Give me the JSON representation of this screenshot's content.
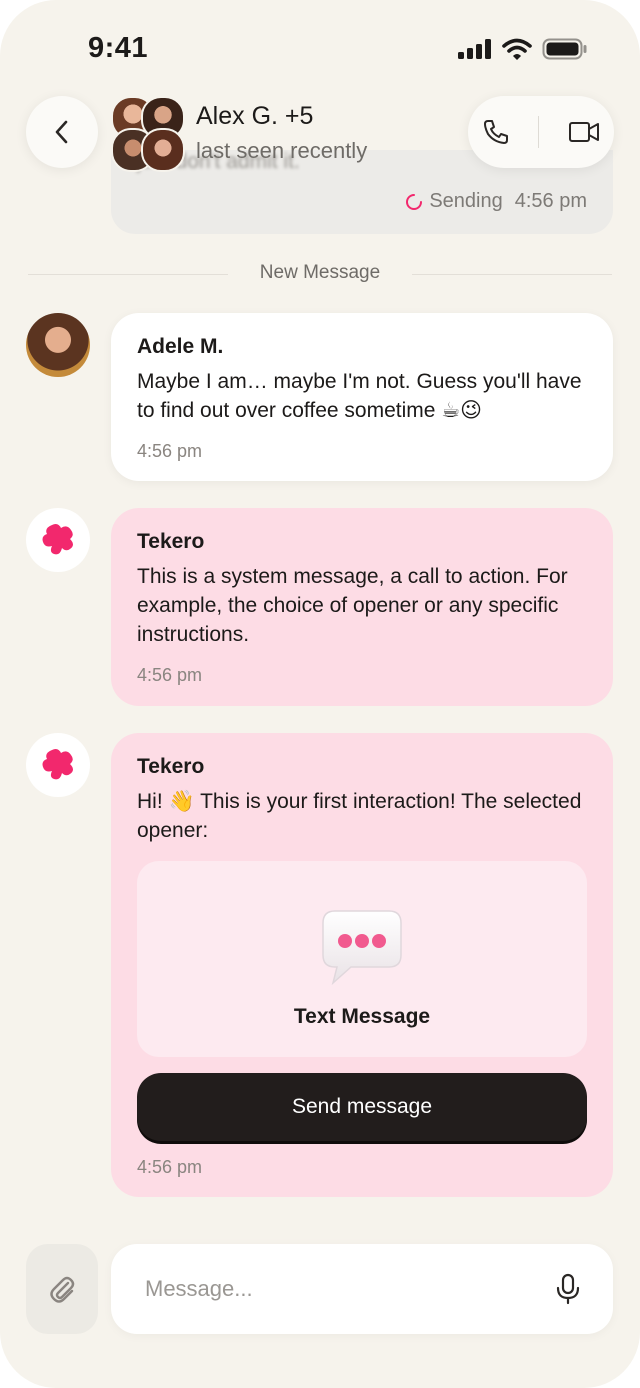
{
  "status_bar": {
    "time": "9:41"
  },
  "previous_message": {
    "text": "just don't admit it.",
    "status": "Sending",
    "time": "4:56 pm"
  },
  "header": {
    "title": "Alex G. +5",
    "subtitle": "last seen recently"
  },
  "divider": {
    "label": "New Message"
  },
  "messages": [
    {
      "sender": "Adele M.",
      "text": "Maybe I am… maybe I'm not. Guess you'll have to find out over coffee sometime ☕😉",
      "time": "4:56 pm"
    },
    {
      "sender": "Tekero",
      "text": "This is a system message, a call to action. For example, the choice of opener or any specific instructions.",
      "time": "4:56 pm"
    },
    {
      "sender": "Tekero",
      "text": "Hi! 👋 This is your first interaction! The selected opener:",
      "opener_label": "Text Message",
      "button_label": "Send message",
      "time": "4:56 pm"
    }
  ],
  "composer": {
    "placeholder": "Message..."
  },
  "colors": {
    "background": "#f6f3ec",
    "pink_bubble": "#fddce5",
    "brand": "#f2286d",
    "button_dark": "#221d1c"
  },
  "icons": [
    "back-chevron-icon",
    "phone-icon",
    "video-icon",
    "spinner-icon",
    "tekero-logo-icon",
    "chat-bubble-icon",
    "paperclip-icon",
    "microphone-icon"
  ]
}
